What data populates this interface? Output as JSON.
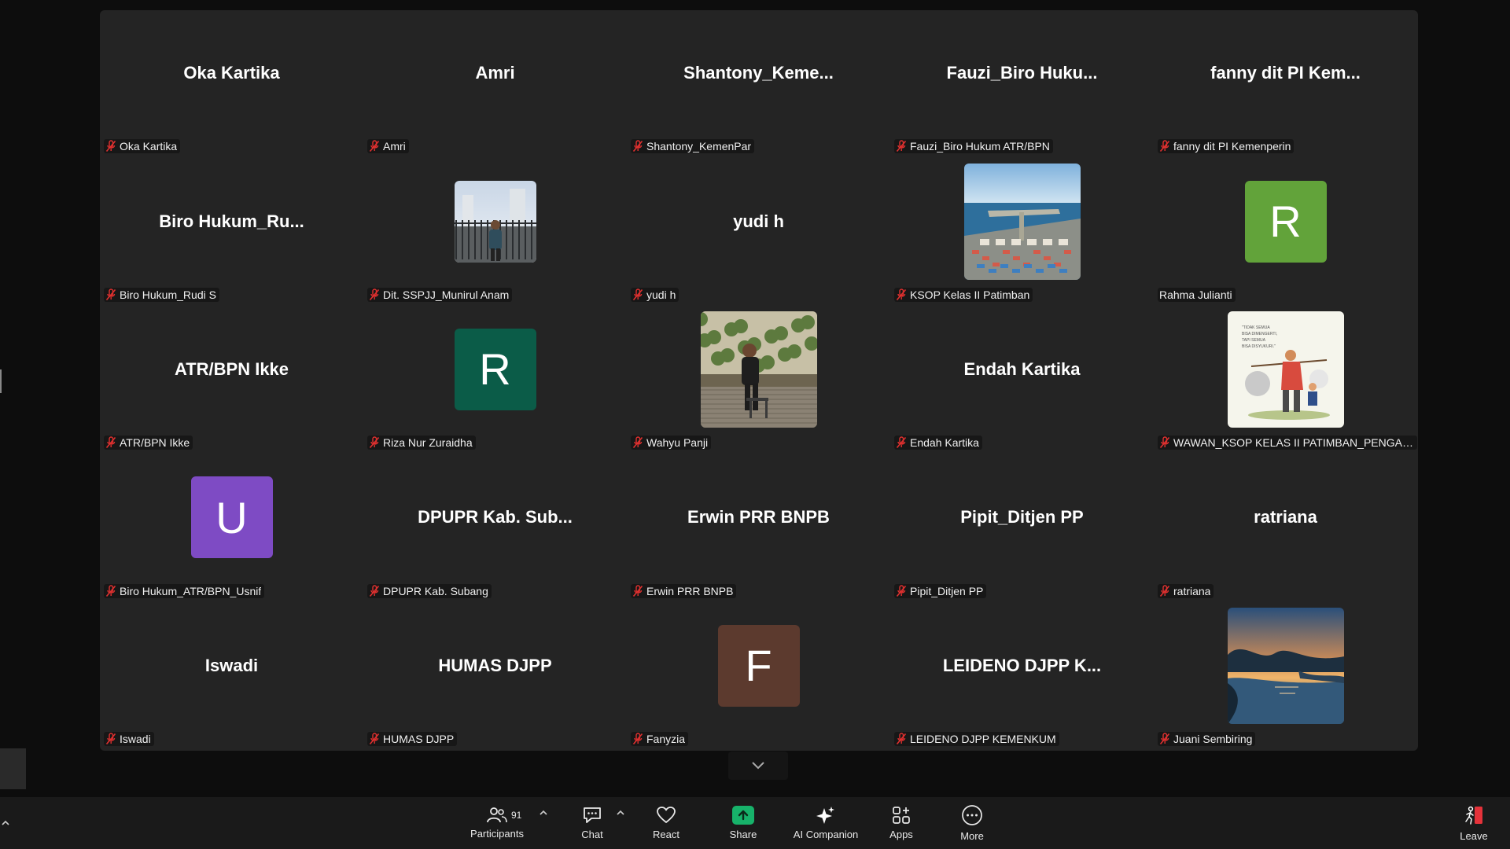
{
  "participants": [
    {
      "display": "Oka Kartika",
      "label": "Oka Kartika",
      "kind": "name",
      "muted": true
    },
    {
      "display": "Amri",
      "label": "Amri",
      "kind": "name",
      "muted": true
    },
    {
      "display": "Shantony_Keme...",
      "label": "Shantony_KemenPar",
      "kind": "name",
      "muted": true
    },
    {
      "display": "Fauzi_Biro  Huku...",
      "label": "Fauzi_Biro Hukum ATR/BPN",
      "kind": "name",
      "muted": true
    },
    {
      "display": "fanny dit PI Kem...",
      "label": "fanny dit PI Kemenperin",
      "kind": "name",
      "muted": true
    },
    {
      "display": "Biro  Hukum_Ru...",
      "label": "Biro Hukum_Rudi S",
      "kind": "name",
      "muted": true
    },
    {
      "display": "",
      "label": "Dit. SSPJJ_Munirul Anam",
      "kind": "photo",
      "photo": "person-fence",
      "muted": true
    },
    {
      "display": "yudi h",
      "label": "yudi h",
      "kind": "name",
      "muted": true
    },
    {
      "display": "",
      "label": "KSOP Kelas II Patimban",
      "kind": "photo",
      "photo": "port-aerial",
      "muted": true
    },
    {
      "display": "",
      "label": "Rahma Julianti",
      "kind": "avatar",
      "initial": "R",
      "color": "#62a33a",
      "muted": false
    },
    {
      "display": "ATR/BPN Ikke",
      "label": "ATR/BPN Ikke",
      "kind": "name",
      "muted": true
    },
    {
      "display": "",
      "label": "Riza Nur Zuraidha",
      "kind": "avatar",
      "initial": "R",
      "color": "#0b5c48",
      "muted": true
    },
    {
      "display": "",
      "label": "Wahyu Panji",
      "kind": "photo",
      "photo": "person-seated",
      "muted": true
    },
    {
      "display": "Endah Kartika",
      "label": "Endah Kartika",
      "kind": "name",
      "muted": true
    },
    {
      "display": "",
      "label": "WAWAN_KSOP KELAS II PATIMBAN_PENGADAA...",
      "kind": "photo",
      "photo": "cartoon",
      "muted": true
    },
    {
      "display": "",
      "label": "Biro Hukum_ATR/BPN_Usnif",
      "kind": "avatar",
      "initial": "U",
      "color": "#7e4bc4",
      "muted": true
    },
    {
      "display": "DPUPR Kab. Sub...",
      "label": "DPUPR Kab. Subang",
      "kind": "name",
      "muted": true
    },
    {
      "display": "Erwin PRR BNPB",
      "label": "Erwin PRR BNPB",
      "kind": "name",
      "muted": true
    },
    {
      "display": "Pipit_Ditjen PP",
      "label": "Pipit_Ditjen PP",
      "kind": "name",
      "muted": true
    },
    {
      "display": "ratriana",
      "label": "ratriana",
      "kind": "name",
      "muted": true
    },
    {
      "display": "Iswadi",
      "label": "Iswadi",
      "kind": "name",
      "muted": true
    },
    {
      "display": "HUMAS DJPP",
      "label": "HUMAS DJPP",
      "kind": "name",
      "muted": true
    },
    {
      "display": "",
      "label": "Fanyzia",
      "kind": "avatar",
      "initial": "F",
      "color": "#5c3a2e",
      "muted": true
    },
    {
      "display": "LEIDENO DJPP K...",
      "label": "LEIDENO DJPP KEMENKUM",
      "kind": "name",
      "muted": true
    },
    {
      "display": "",
      "label": "Juani Sembiring",
      "kind": "photo",
      "photo": "lake-sunset",
      "muted": true
    }
  ],
  "toolbar": {
    "participants_label": "Participants",
    "participants_count": "91",
    "chat_label": "Chat",
    "react_label": "React",
    "share_label": "Share",
    "ai_label": "AI Companion",
    "apps_label": "Apps",
    "more_label": "More",
    "leave_label": "Leave"
  },
  "colors": {
    "share_green": "#17b26a",
    "muted_red": "#e0302f",
    "leave_red": "#e5323a"
  }
}
